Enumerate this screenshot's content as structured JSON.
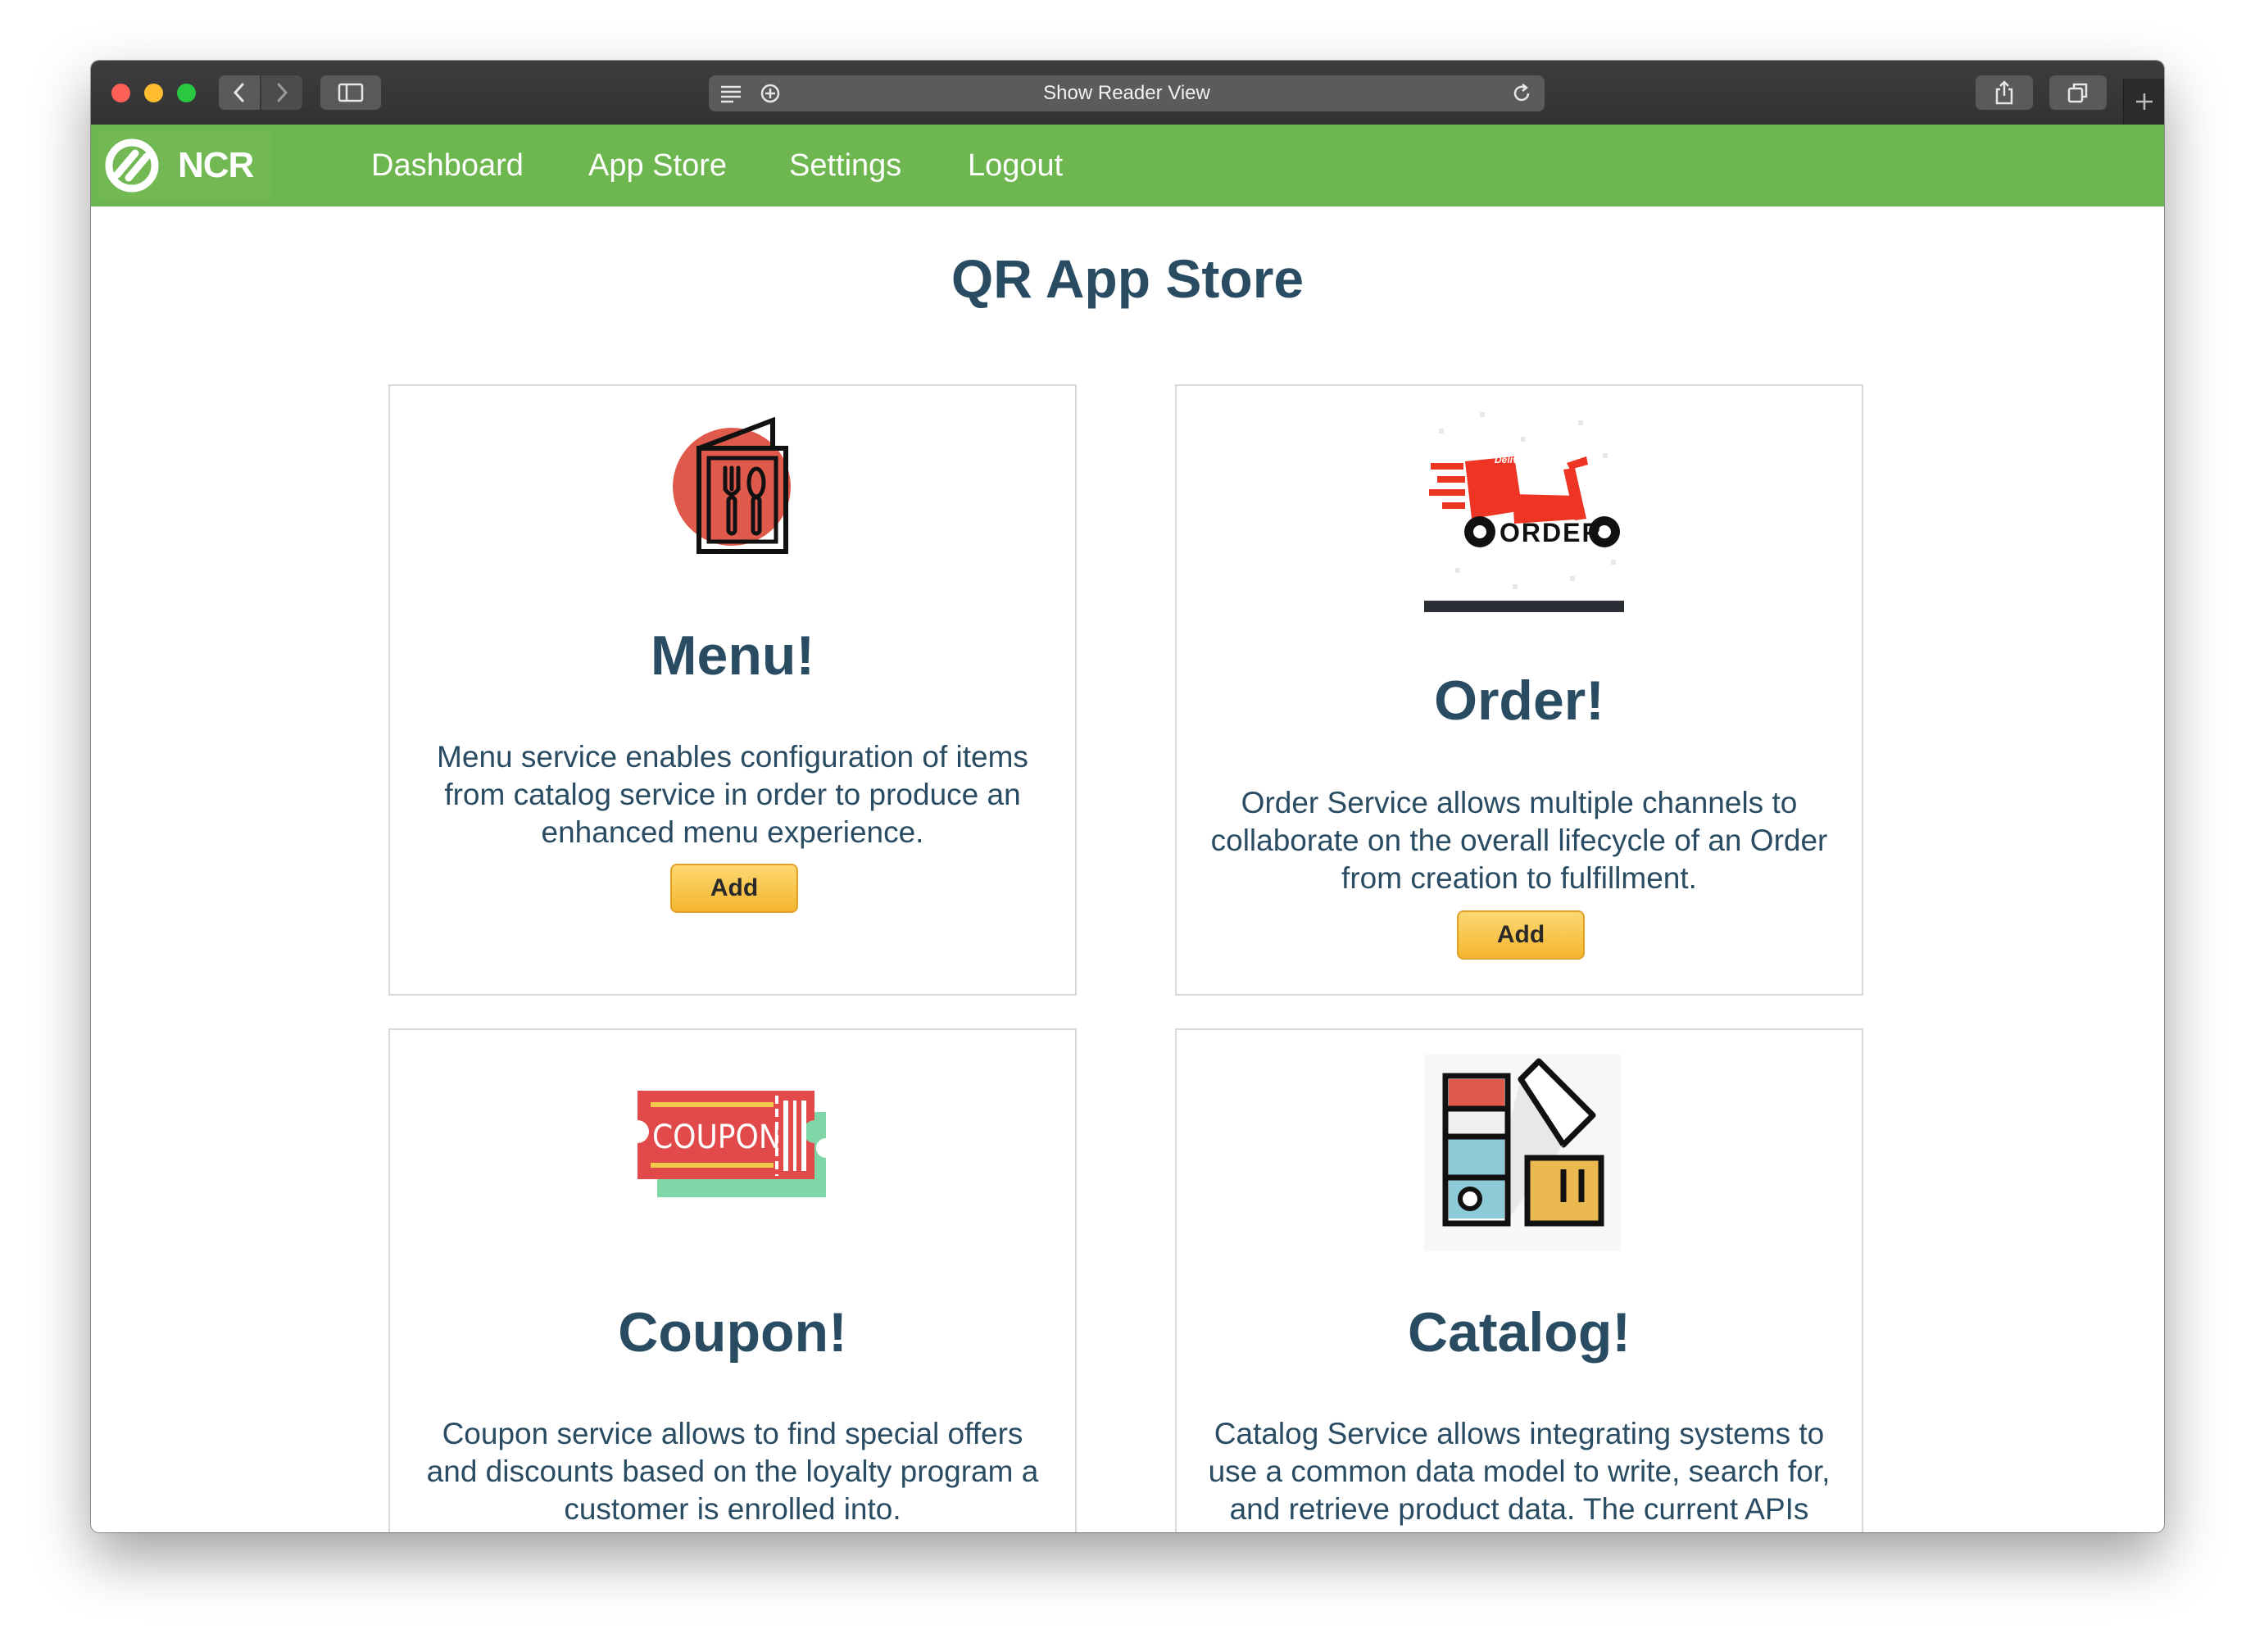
{
  "browser": {
    "address_text": "Show Reader View"
  },
  "navbar": {
    "logo_text": "NCR",
    "items": [
      {
        "label": "Dashboard"
      },
      {
        "label": "App Store"
      },
      {
        "label": "Settings"
      },
      {
        "label": "Logout"
      }
    ]
  },
  "page": {
    "title": "QR App Store"
  },
  "cards": [
    {
      "title": "Menu!",
      "description": "Menu service enables configuration of items from catalog service in order to produce an enhanced menu experience.",
      "button_label": "Add",
      "icon": "menu-icon"
    },
    {
      "title": "Order!",
      "description": "Order Service allows multiple channels to collaborate on the overall lifecycle of an Order from creation to fulfillment.",
      "button_label": "Add",
      "icon": "order-delivery-icon",
      "image_text": "ORDER"
    },
    {
      "title": "Coupon!",
      "description": "Coupon service allows to find special offers and discounts based on the loyalty program a customer is enrolled into.",
      "icon": "coupon-icon",
      "image_text": "COUPON"
    },
    {
      "title": "Catalog!",
      "description": "Catalog Service allows integrating systems to use a common data model to write, search for, and retrieve product data. The current APIs",
      "icon": "catalog-swatch-icon"
    }
  ],
  "colors": {
    "navbar": "#6eb64f",
    "heading": "#294c63",
    "button": "#f4b530"
  }
}
